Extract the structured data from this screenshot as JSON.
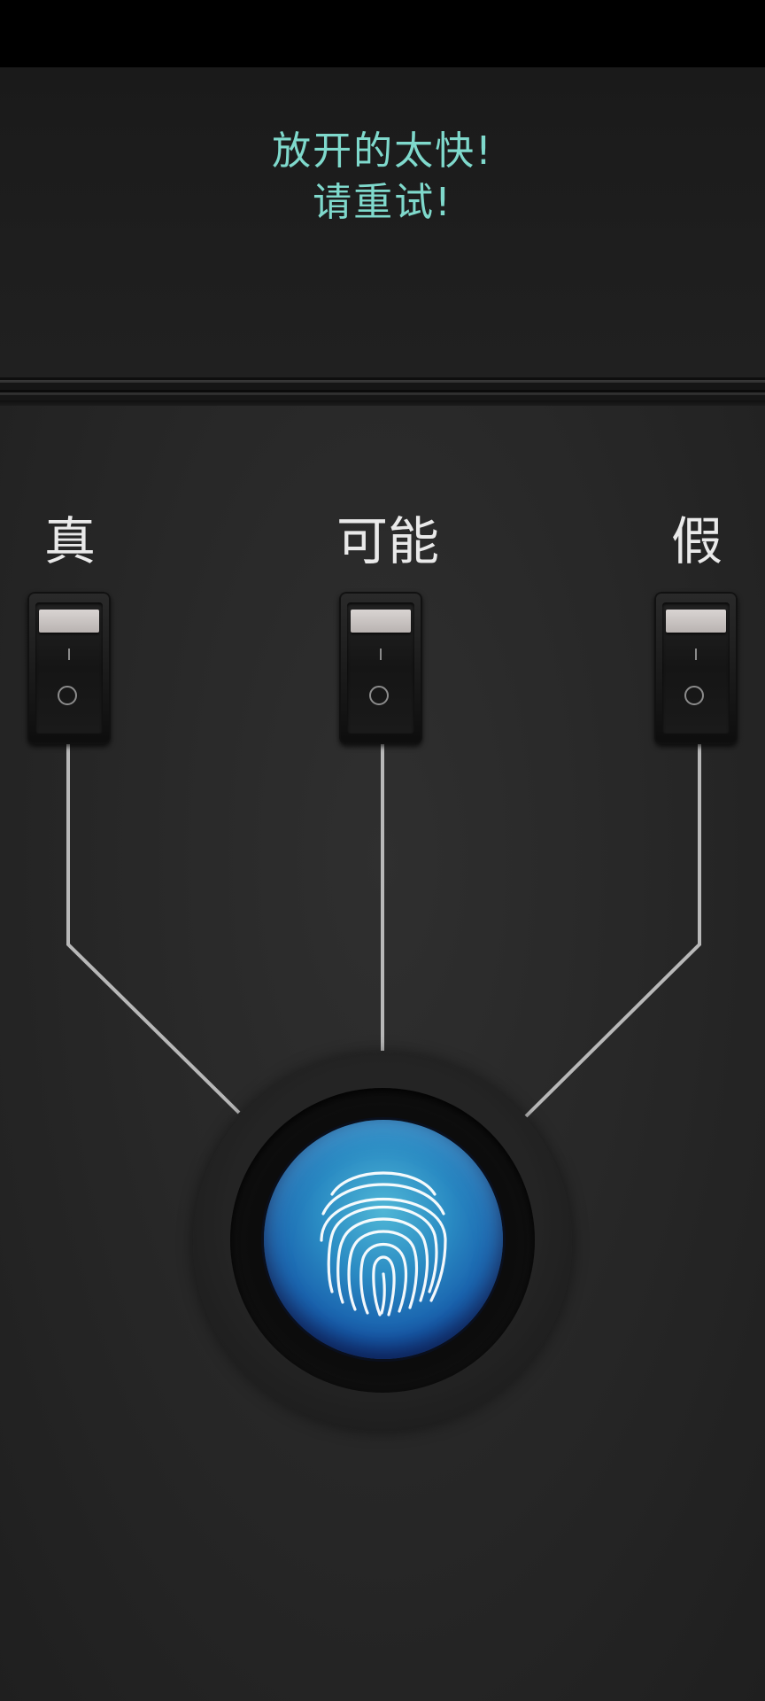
{
  "message": {
    "line1": "放开的太快!",
    "line2": "请重试!",
    "color": "#7fd9cc"
  },
  "options": [
    {
      "label": "真"
    },
    {
      "label": "可能"
    },
    {
      "label": "假"
    }
  ],
  "fingerprint_button": {
    "icon": "fingerprint-icon",
    "color": "#2a8bc3"
  },
  "colors": {
    "background": "#232323",
    "wire": "#b8b8b8"
  }
}
